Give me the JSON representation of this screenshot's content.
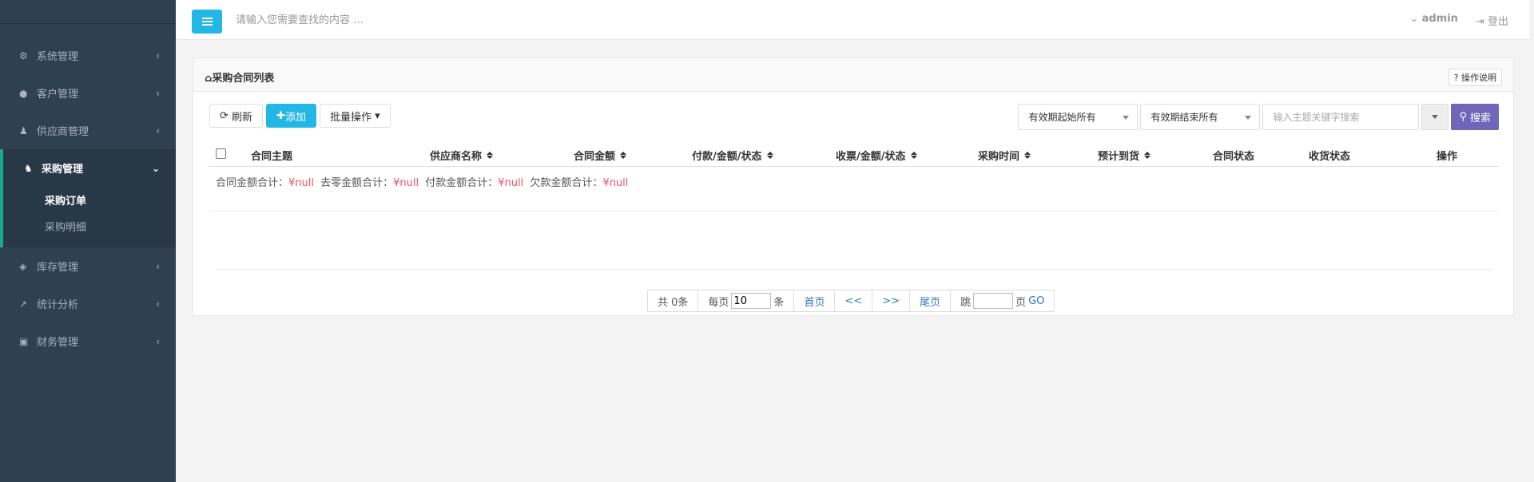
{
  "sidebar": {
    "items": [
      {
        "label": "系统管理",
        "icon": "cogs-icon"
      },
      {
        "label": "客户管理",
        "icon": "user-icon"
      },
      {
        "label": "供应商管理",
        "icon": "users-icon"
      }
    ],
    "active_group": {
      "label": "采购管理",
      "icon": "user-secret-icon",
      "subitems": [
        {
          "label": "采购订单",
          "active": true
        },
        {
          "label": "采购明细",
          "active": false
        }
      ]
    },
    "items_after": [
      {
        "label": "库存管理",
        "icon": "cube-icon"
      },
      {
        "label": "统计分析",
        "icon": "line-chart-icon"
      },
      {
        "label": "财务管理",
        "icon": "money-icon"
      }
    ]
  },
  "topbar": {
    "search_placeholder": "请输入您需要查找的内容 …",
    "user": "admin",
    "logout": "登出"
  },
  "panel": {
    "title": "采购合同列表",
    "help": "操作说明"
  },
  "toolbar": {
    "refresh": "刷新",
    "add": "添加",
    "batch": "批量操作"
  },
  "filters": {
    "start": "有效期起始所有",
    "end": "有效期结束所有",
    "keyword_placeholder": "输入主题关键字搜索",
    "search": "搜索"
  },
  "table": {
    "columns": [
      "合同主题",
      "供应商名称",
      "合同金额",
      "付款/金额/状态",
      "收票/金额/状态",
      "采购时间",
      "预计到货",
      "合同状态",
      "收货状态",
      "操作"
    ]
  },
  "summary": {
    "items": [
      {
        "label": "合同金额合计：",
        "value": "¥null"
      },
      {
        "label": "去零金额合计：",
        "value": "¥null"
      },
      {
        "label": "付款金额合计：",
        "value": "¥null"
      },
      {
        "label": "欠款金额合计：",
        "value": "¥null"
      }
    ]
  },
  "pager": {
    "total": "共 0条",
    "per_page_label": "每页",
    "per_page_value": "10",
    "per_page_unit": "条",
    "first": "首页",
    "prev": "<<",
    "next": ">>",
    "last": "尾页",
    "jump_label": "跳",
    "jump_unit": "页",
    "go": "GO"
  },
  "colors": {
    "sidebar_bg": "#2f4050",
    "accent_blue": "#23b7e5",
    "search_purple": "#7266ba",
    "active_border": "#19aa8d",
    "value_red": "#ed5565"
  }
}
